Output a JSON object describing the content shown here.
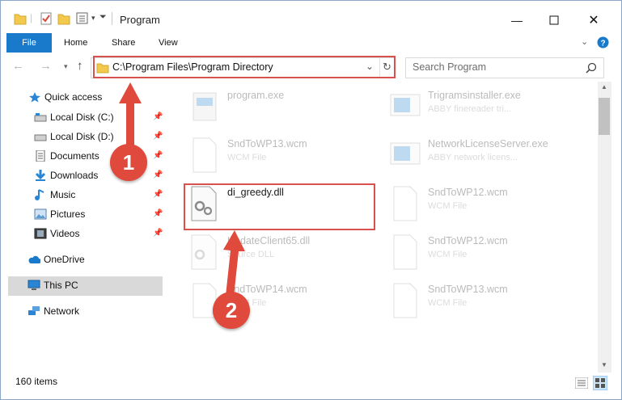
{
  "window": {
    "title": "Program"
  },
  "ribbon": {
    "tabs": [
      "File",
      "Home",
      "Share",
      "View"
    ]
  },
  "address": {
    "path": "C:\\Program Files\\Program Directory"
  },
  "search": {
    "placeholder": "Search Program"
  },
  "sidebar": {
    "quick_access": "Quick access",
    "items": [
      {
        "label": "Local Disk (C:)",
        "icon": "drive-icon",
        "pinned": true
      },
      {
        "label": "Local Disk (D:)",
        "icon": "drive-icon",
        "pinned": true
      },
      {
        "label": "Documents",
        "icon": "documents-icon",
        "pinned": true
      },
      {
        "label": "Downloads",
        "icon": "downloads-icon",
        "pinned": true
      },
      {
        "label": "Music",
        "icon": "music-icon",
        "pinned": true
      },
      {
        "label": "Pictures",
        "icon": "pictures-icon",
        "pinned": true
      },
      {
        "label": "Videos",
        "icon": "videos-icon",
        "pinned": true
      }
    ],
    "onedrive": "OneDrive",
    "thispc": "This PC",
    "network": "Network"
  },
  "files": [
    {
      "name": "program.exe",
      "desc": ""
    },
    {
      "name": "Trigramsinstaller.exe",
      "desc": "ABBY finereader tri..."
    },
    {
      "name": "SndToWP13.wcm",
      "desc": "WCM File"
    },
    {
      "name": "NetworkLicenseServer.exe",
      "desc": "ABBY network licens..."
    },
    {
      "name": "di_greedy.dll",
      "desc": ""
    },
    {
      "name": "SndToWP12.wcm",
      "desc": "WCM File"
    },
    {
      "name": "UpdateClient65.dll",
      "desc": "Source DLL"
    },
    {
      "name": "SndToWP12.wcm",
      "desc": "WCM File"
    },
    {
      "name": "SndToWP14.wcm",
      "desc": "WCM File"
    },
    {
      "name": "SndToWP13.wcm",
      "desc": "WCM File"
    }
  ],
  "status": {
    "count": "160 items"
  },
  "annotations": {
    "step1": "1",
    "step2": "2"
  },
  "colors": {
    "accent": "#1979ca",
    "highlight": "#d9514c",
    "badge": "#df4a3c"
  }
}
